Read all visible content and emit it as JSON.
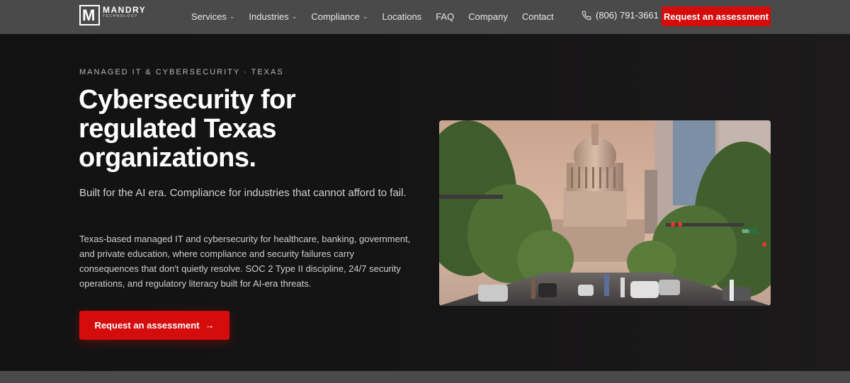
{
  "header": {
    "logo_name": "MANDRY",
    "logo_sub": "TECHNOLOGY",
    "logo_letter": "M",
    "nav": [
      {
        "label": "Services",
        "dropdown": true
      },
      {
        "label": "Industries",
        "dropdown": true
      },
      {
        "label": "Compliance",
        "dropdown": true
      },
      {
        "label": "Locations",
        "dropdown": false
      },
      {
        "label": "FAQ",
        "dropdown": false
      },
      {
        "label": "Company",
        "dropdown": false
      },
      {
        "label": "Contact",
        "dropdown": false
      }
    ],
    "phone": "(806) 791-3661",
    "cta_label": "Request an assessment"
  },
  "hero": {
    "eyebrow": "MANAGED IT & CYBERSECURITY · TEXAS",
    "headline_lines": [
      "Cybersecurity for",
      "regulated Texas",
      "organizations."
    ],
    "subhead": "Built for the AI era. Compliance for industries that cannot afford to fail.",
    "body": "Texas-based managed IT and cybersecurity for healthcare, banking, government, and private education, where compliance and security failures carry consequences that don't quietly resolve. SOC 2 Type II discipline, 24/7 security operations, and regulatory literacy built for AI-era threats.",
    "cta_label": "Request an assessment",
    "cta_arrow": "→",
    "image_signs": [
      "6th"
    ]
  },
  "colors": {
    "accent": "#d40c0c",
    "header_bg": "#4a4a4a",
    "hero_bg": "#141414"
  },
  "icons": {
    "phone": "phone-icon",
    "chevron": "chevron-down-icon",
    "arrow": "arrow-right-icon"
  }
}
